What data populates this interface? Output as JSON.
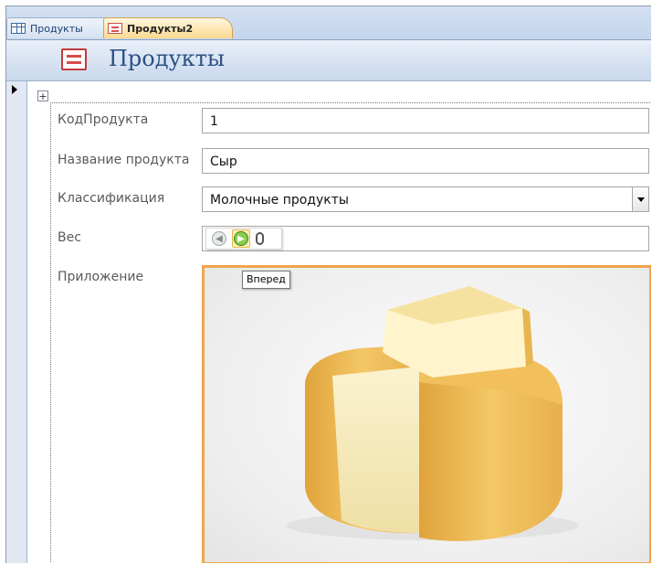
{
  "tabs": [
    {
      "label": "Продукты",
      "active": false,
      "icon": "table-icon"
    },
    {
      "label": "Продукты2",
      "active": true,
      "icon": "form-icon"
    }
  ],
  "form": {
    "title": "Продукты",
    "fields": [
      {
        "label": "КодПродукта",
        "value": "1"
      },
      {
        "label": "Название продукта",
        "value": "Сыр"
      },
      {
        "label": "Классификация",
        "value": "Молочные продукты"
      },
      {
        "label": "Вес",
        "value": ""
      },
      {
        "label": "Приложение",
        "value": ""
      }
    ]
  },
  "attachment_toolbar": {
    "buttons": [
      "back-icon",
      "forward-icon",
      "paperclip-icon"
    ],
    "tooltip": "Вперед"
  },
  "colors": {
    "accent": "#f1a54a",
    "header_text": "#2a4f85",
    "tab_active": "#fbd98f"
  }
}
